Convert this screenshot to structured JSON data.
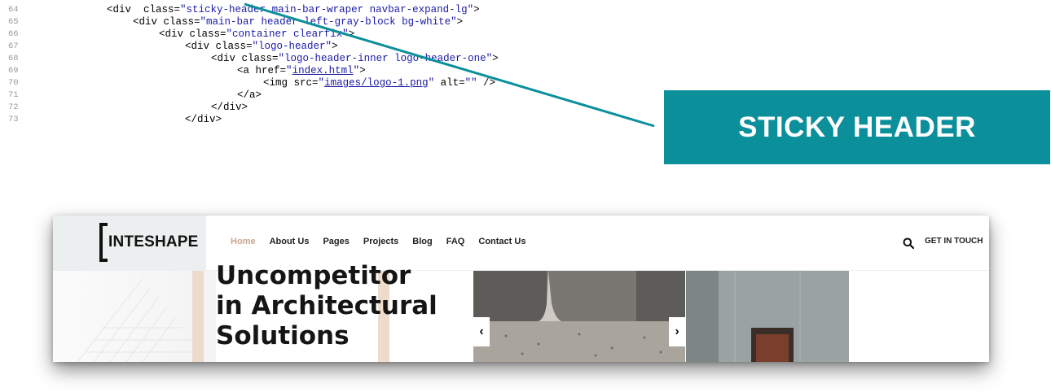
{
  "code_lines": [
    {
      "ln": "64",
      "tokens": [
        [
          "tag",
          "<div  "
        ],
        [
          "attr",
          "class"
        ],
        [
          "eq",
          "="
        ],
        [
          "val",
          "\"sticky-header main-bar-wraper navbar-expand-lg\""
        ],
        [
          "tag",
          ">"
        ]
      ]
    },
    {
      "ln": "65",
      "tokens": [
        [
          "tag",
          "<div "
        ],
        [
          "attr",
          "class"
        ],
        [
          "eq",
          "="
        ],
        [
          "val",
          "\"main-bar header-left-gray-block bg-white\""
        ],
        [
          "tag",
          ">"
        ]
      ]
    },
    {
      "ln": "66",
      "tokens": [
        [
          "tag",
          "<div "
        ],
        [
          "attr",
          "class"
        ],
        [
          "eq",
          "="
        ],
        [
          "val",
          "\"container clearfix\""
        ],
        [
          "tag",
          ">"
        ]
      ]
    },
    {
      "ln": "67",
      "tokens": [
        [
          "tag",
          "<div "
        ],
        [
          "attr",
          "class"
        ],
        [
          "eq",
          "="
        ],
        [
          "val",
          "\"logo-header\""
        ],
        [
          "tag",
          ">"
        ]
      ]
    },
    {
      "ln": "68",
      "tokens": [
        [
          "tag",
          "<div "
        ],
        [
          "attr",
          "class"
        ],
        [
          "eq",
          "="
        ],
        [
          "val",
          "\"logo-header-inner logo-header-one\""
        ],
        [
          "tag",
          ">"
        ]
      ]
    },
    {
      "ln": "69",
      "tokens": [
        [
          "tag",
          "<a "
        ],
        [
          "attr",
          "href"
        ],
        [
          "eq",
          "="
        ],
        [
          "val",
          "\""
        ],
        [
          "link",
          "index.html"
        ],
        [
          "val",
          "\""
        ],
        [
          "tag",
          ">"
        ]
      ]
    },
    {
      "ln": "70",
      "tokens": [
        [
          "tag",
          "<img "
        ],
        [
          "attr",
          "src"
        ],
        [
          "eq",
          "="
        ],
        [
          "val",
          "\""
        ],
        [
          "link",
          "images/logo-1.png"
        ],
        [
          "val",
          "\""
        ],
        [
          "attr",
          " alt"
        ],
        [
          "eq",
          "="
        ],
        [
          "val",
          "\"\""
        ],
        [
          "tag",
          " />"
        ]
      ]
    },
    {
      "ln": "71",
      "tokens": [
        [
          "tag",
          "</a>"
        ]
      ]
    },
    {
      "ln": "72",
      "tokens": [
        [
          "tag",
          "</div>"
        ]
      ]
    },
    {
      "ln": "73",
      "tokens": [
        [
          "tag",
          "</div>"
        ]
      ]
    }
  ],
  "callout": {
    "label": "STICKY HEADER",
    "color": "#0b8f9b"
  },
  "site": {
    "logo_text": "INTESHAPE",
    "nav": [
      {
        "label": "Home",
        "active": true
      },
      {
        "label": "About Us",
        "active": false
      },
      {
        "label": "Pages",
        "active": false
      },
      {
        "label": "Projects",
        "active": false
      },
      {
        "label": "Blog",
        "active": false
      },
      {
        "label": "FAQ",
        "active": false
      },
      {
        "label": "Contact Us",
        "active": false
      }
    ],
    "search_icon": "search-icon",
    "cta_label": "GET IN TOUCH",
    "hero": {
      "title_lines": [
        "Uncompetitor",
        "in Architectural",
        "Solutions"
      ],
      "prev_arrow": "‹",
      "next_arrow": "›"
    },
    "accent_color": "#c9a690"
  }
}
